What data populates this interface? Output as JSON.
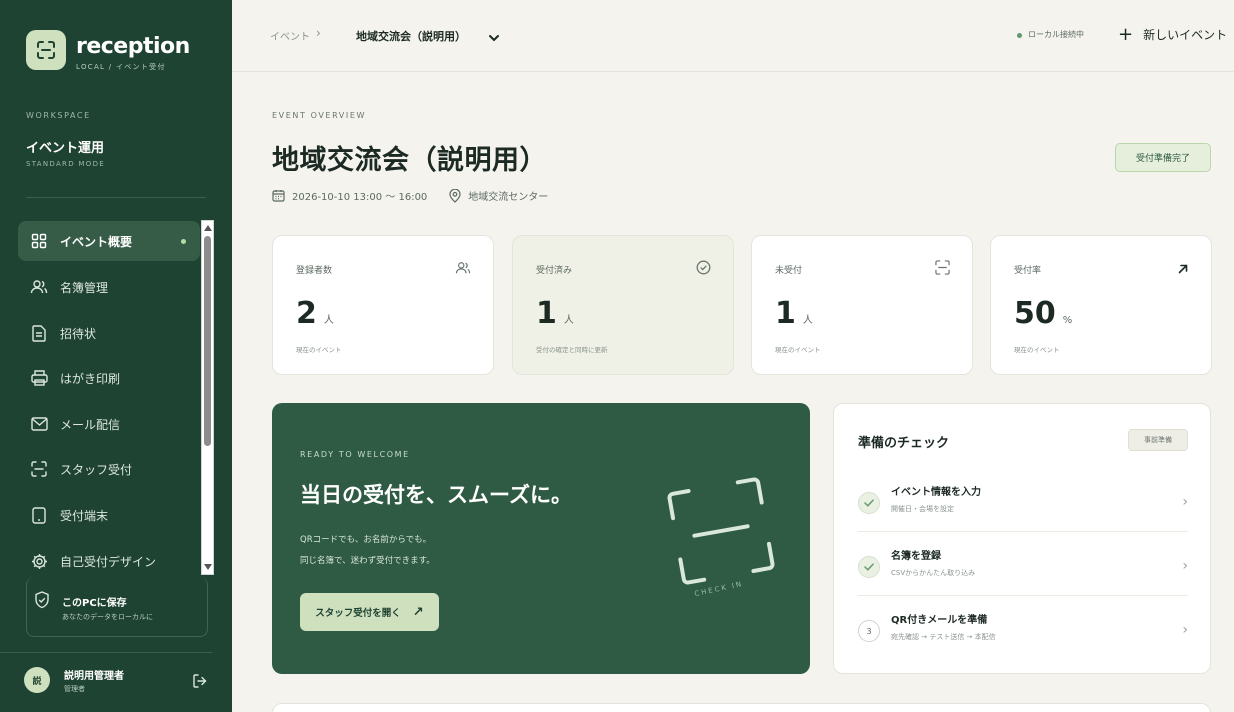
{
  "sidebar": {
    "logo_text": "reception",
    "logo_sub": "LOCAL / イベント受付",
    "workspace_label": "WORKSPACE",
    "workspace_name": "イベント運用",
    "workspace_mode": "STANDARD MODE",
    "items": [
      {
        "label": "イベント概要",
        "icon": "grid-icon",
        "active": true
      },
      {
        "label": "名簿管理",
        "icon": "users-icon"
      },
      {
        "label": "招待状",
        "icon": "document-icon"
      },
      {
        "label": "はがき印刷",
        "icon": "printer-icon"
      },
      {
        "label": "メール配信",
        "icon": "mail-icon"
      },
      {
        "label": "スタッフ受付",
        "icon": "scan-icon"
      },
      {
        "label": "受付端末",
        "icon": "tablet-icon"
      },
      {
        "label": "自己受付デザイン",
        "icon": "gear-icon"
      }
    ],
    "save": {
      "title": "このPCに保存",
      "sub": "あなたのデータをローカルに"
    },
    "user": {
      "avatar": "説",
      "name": "説明用管理者",
      "role": "管理者"
    }
  },
  "topbar": {
    "crumb_root": "イベント",
    "crumb_sep": "›",
    "crumb_current": "地域交流会（説明用）",
    "connection": "ローカル接続中",
    "new_event": "新しいイベント"
  },
  "overview": {
    "label": "EVENT OVERVIEW",
    "title": "地域交流会（説明用）",
    "datetime": "2026-10-10 13:00 ～ 16:00",
    "venue": "地域交流センター",
    "ready_button": "受付準備完了"
  },
  "stats": [
    {
      "label": "登録者数",
      "value": "2",
      "unit": "人",
      "note": "現在のイベント",
      "icon": "users-icon"
    },
    {
      "label": "受付済み",
      "value": "1",
      "unit": "人",
      "note": "受付の確定と同時に更新",
      "icon": "check-circle-icon"
    },
    {
      "label": "未受付",
      "value": "1",
      "unit": "人",
      "note": "現在のイベント",
      "icon": "scan-icon"
    },
    {
      "label": "受付率",
      "value": "50",
      "unit": "%",
      "note": "現在のイベント",
      "icon": "arrow-up-right-icon"
    }
  ],
  "hero": {
    "label": "READY TO WELCOME",
    "title": "当日の受付を、スムーズに。",
    "desc1": "QRコードでも、お名前からでも。",
    "desc2": "同じ名簿で、迷わず受付できます。",
    "button": "スタッフ受付を開く",
    "art_text": "CHECK IN"
  },
  "checklist": {
    "title": "準備のチェック",
    "badge": "事前準備",
    "tasks": [
      {
        "title": "イベント情報を入力",
        "sub": "開催日・会場を設定",
        "done": true,
        "num": ""
      },
      {
        "title": "名簿を登録",
        "sub": "CSVからかんたん取り込み",
        "done": true,
        "num": ""
      },
      {
        "title": "QR付きメールを準備",
        "sub": "宛先確認 → テスト送信 → 本配信",
        "done": false,
        "num": "3"
      }
    ]
  },
  "colors": {
    "sidebar": "#1f4332",
    "accent": "#2f5b44",
    "accent_light": "#cfe0bf",
    "background": "#f4f3ee"
  }
}
